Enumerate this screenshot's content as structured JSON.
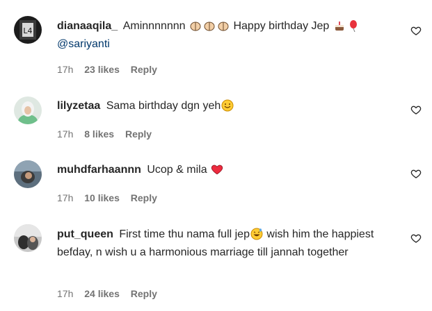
{
  "colors": {
    "text": "#262626",
    "meta": "#737373",
    "mention": "#00376b",
    "heart_red": "#ed2b3f"
  },
  "comments": [
    {
      "username": "dianaaqila_",
      "text_before_emoji": "Aminnnnnnn",
      "emojis_1": [
        "folded-hands",
        "folded-hands",
        "folded-hands"
      ],
      "text_after_emoji": "Happy birthday Jep",
      "emojis_2": [
        "birthday-cake",
        "balloon"
      ],
      "mention": "@sariyanti",
      "time": "17h",
      "likes": "23 likes",
      "reply": "Reply"
    },
    {
      "username": "lilyzetaa",
      "text": "Sama birthday dgn yeh",
      "emoji": "smiling-face",
      "time": "17h",
      "likes": "8 likes",
      "reply": "Reply"
    },
    {
      "username": "muhdfarhaannn",
      "text": "Ucop & mila",
      "emoji": "red-heart",
      "time": "17h",
      "likes": "10 likes",
      "reply": "Reply"
    },
    {
      "username": "put_queen",
      "text_before_emoji": "First time thu nama full jep",
      "emoji": "grinning-sweat-face",
      "text_after_emoji": " wish him the happiest befday, n wish u a harmonious marriage till jannah together",
      "time": "17h",
      "likes": "24 likes",
      "reply": "Reply"
    }
  ]
}
